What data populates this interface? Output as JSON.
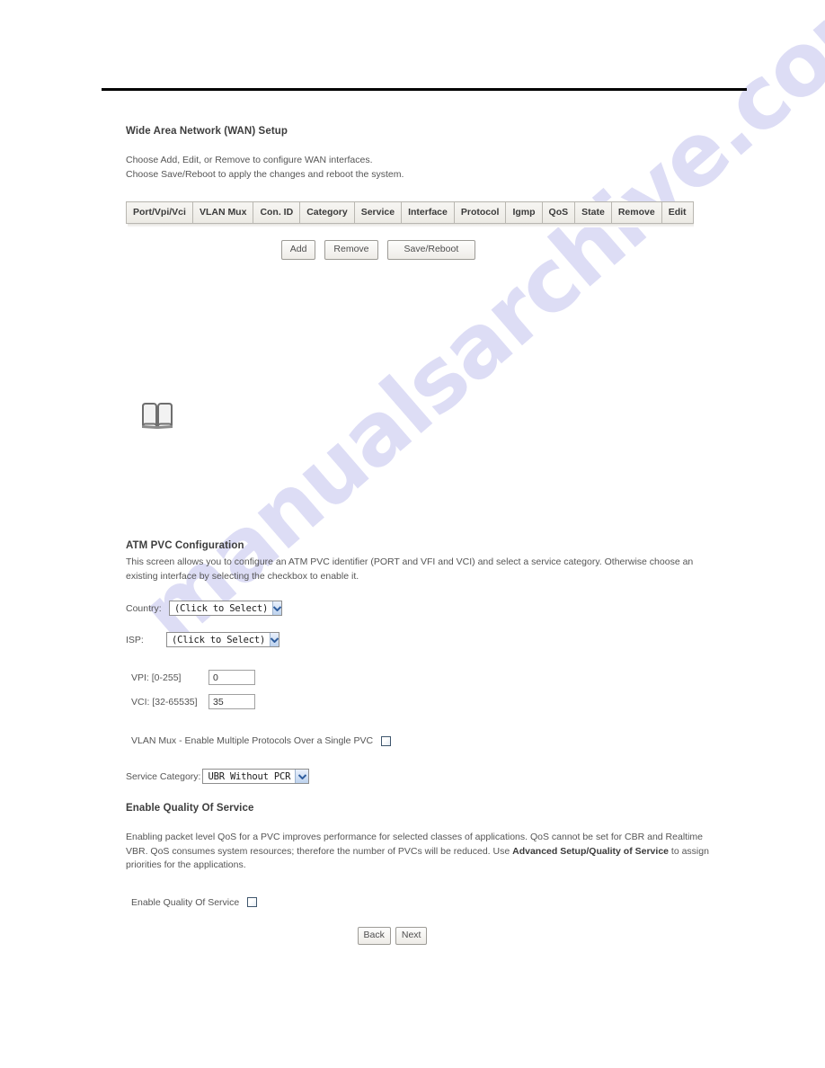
{
  "watermark": {
    "text": "manualsarchive.com"
  },
  "wan_setup": {
    "title": "Wide Area Network (WAN) Setup",
    "intro_line1": "Choose Add, Edit, or Remove to configure WAN interfaces.",
    "intro_line2": "Choose Save/Reboot to apply the changes and reboot the system.",
    "table": {
      "columns": [
        "Port/Vpi/Vci",
        "VLAN Mux",
        "Con. ID",
        "Category",
        "Service",
        "Interface",
        "Protocol",
        "Igmp",
        "QoS",
        "State",
        "Remove",
        "Edit"
      ],
      "rows": []
    },
    "buttons": {
      "add": "Add",
      "remove": "Remove",
      "save_reboot": "Save/Reboot"
    }
  },
  "note": {
    "icon": "open-book-icon"
  },
  "atm_pvc": {
    "title": "ATM PVC Configuration",
    "description": "This screen allows you to configure an ATM PVC identifier (PORT and VFI and VCI) and select a service category. Otherwise choose an existing interface by selecting the checkbox to enable it.",
    "country": {
      "label": "Country:",
      "value": "(Click to Select)"
    },
    "isp": {
      "label": "ISP:",
      "value": "(Click to Select)"
    },
    "vpi": {
      "label": "VPI: [0-255]",
      "value": "0"
    },
    "vci": {
      "label": "VCI: [32-65535]",
      "value": "35"
    },
    "vlan_mux": {
      "label": "VLAN Mux - Enable Multiple Protocols Over a Single PVC",
      "checked": false
    },
    "service_category": {
      "label": "Service Category:",
      "value": "UBR Without PCR"
    }
  },
  "qos": {
    "title": "Enable Quality Of Service",
    "desc_part1": "Enabling packet level QoS for a PVC improves performance for selected classes of applications.  QoS cannot be set for CBR and Realtime VBR.  QoS consumes system resources; therefore the number of PVCs will be reduced. Use ",
    "desc_bold1": "Advanced Setup/Quality of Service",
    "desc_part2": " to assign priorities for the applications.",
    "checkbox_label": "Enable Quality Of Service",
    "checked": false
  },
  "nav": {
    "back": "Back",
    "next": "Next"
  }
}
